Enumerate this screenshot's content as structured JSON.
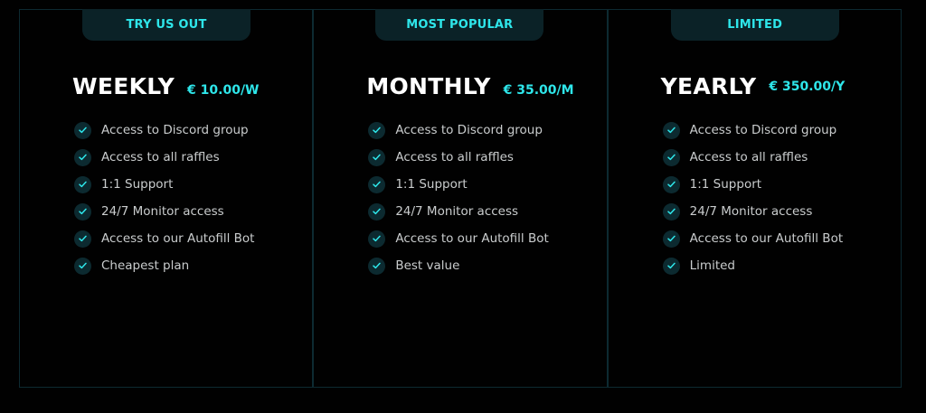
{
  "theme": {
    "background": "#010101",
    "accent": "#2ee6ea",
    "tab_background": "#0b2227",
    "border": "#0d2a31",
    "check_background": "#0c2a30"
  },
  "plans": [
    {
      "tab_label": "TRY US OUT",
      "name": "WEEKLY",
      "price": "€ 10.00/W",
      "features": [
        "Access to Discord group",
        "Access to all raffles",
        "1:1 Support",
        "24/7 Monitor access",
        "Access to our Autofill Bot",
        "Cheapest plan"
      ]
    },
    {
      "tab_label": "MOST POPULAR",
      "name": "MONTHLY",
      "price": "€ 35.00/M",
      "features": [
        "Access to Discord group",
        "Access to all raffles",
        "1:1 Support",
        "24/7 Monitor access",
        "Access to our Autofill Bot",
        "Best value"
      ]
    },
    {
      "tab_label": "LIMITED",
      "name": "YEARLY",
      "price": "€ 350.00/Y",
      "features": [
        "Access to Discord group",
        "Access to all raffles",
        "1:1 Support",
        "24/7 Monitor access",
        "Access to our Autofill Bot",
        "Limited"
      ]
    }
  ],
  "icons": {
    "feature_check": "check-circle-icon"
  }
}
